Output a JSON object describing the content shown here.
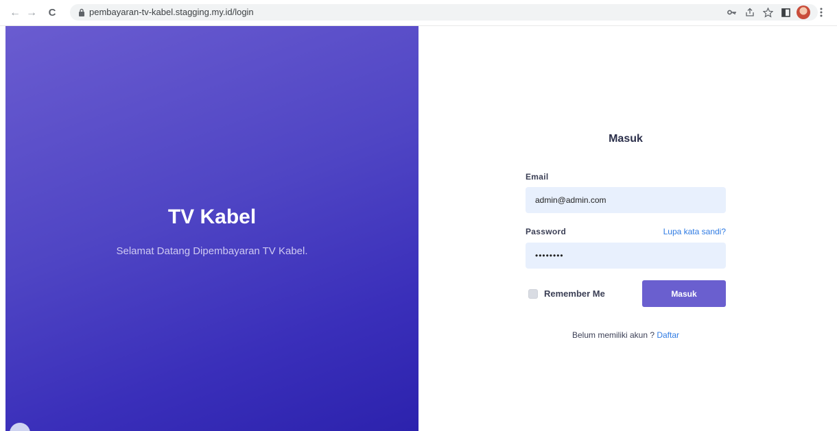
{
  "browser": {
    "url": "pembayaran-tv-kabel.stagging.my.id/login",
    "back_glyph": "←",
    "forward_glyph": "→",
    "reload_glyph": "C"
  },
  "hero": {
    "title": "TV Kabel",
    "subtitle": "Selamat Datang Dipembayaran TV Kabel."
  },
  "login": {
    "title": "Masuk",
    "email_label": "Email",
    "email_value": "admin@admin.com",
    "password_label": "Password",
    "password_value": "••••••••",
    "forgot_link": "Lupa kata sandi?",
    "remember_label": "Remember Me",
    "submit_label": "Masuk",
    "signup_prompt": "Belum memiliki akun ? ",
    "signup_link": "Daftar"
  },
  "colors": {
    "accent": "#6a5fcf",
    "link": "#2f7be3",
    "input_bg": "#e8f0fd"
  },
  "icons": [
    "back-arrow-icon",
    "forward-arrow-icon",
    "reload-icon",
    "lock-icon",
    "key-icon",
    "share-icon",
    "star-icon",
    "side-panel-icon",
    "profile-avatar-icon",
    "more-menu-icon"
  ]
}
